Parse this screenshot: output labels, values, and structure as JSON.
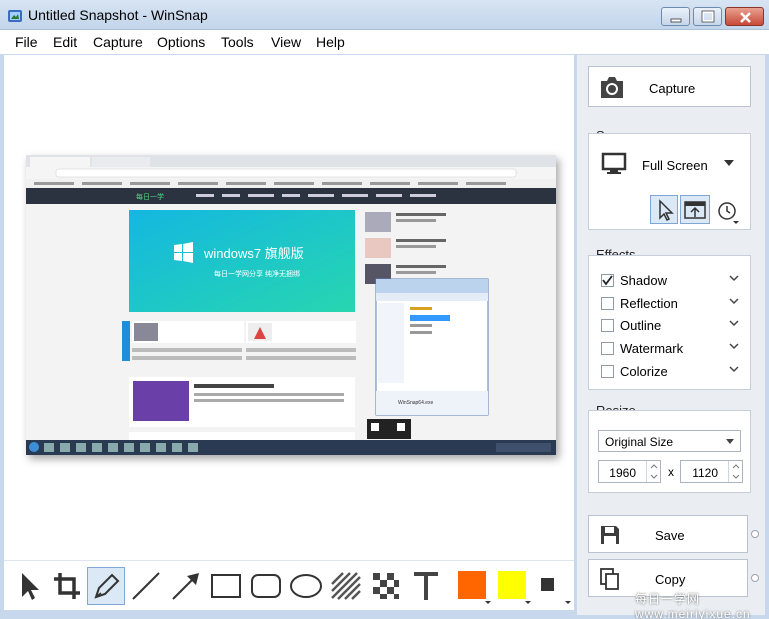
{
  "window": {
    "title": "Untitled Snapshot - WinSnap"
  },
  "menu": [
    "File",
    "Edit",
    "Capture",
    "Options",
    "Tools",
    "View",
    "Help"
  ],
  "panel": {
    "capture_label": "Capture",
    "source": {
      "title": "Source",
      "mode": "Full Screen"
    },
    "effects": {
      "title": "Effects",
      "items": [
        {
          "label": "Shadow",
          "checked": true
        },
        {
          "label": "Reflection",
          "checked": false
        },
        {
          "label": "Outline",
          "checked": false
        },
        {
          "label": "Watermark",
          "checked": false
        },
        {
          "label": "Colorize",
          "checked": false
        }
      ]
    },
    "resize": {
      "title": "Resize",
      "mode": "Original Size",
      "width": "1960",
      "separator": "x",
      "height": "1120"
    },
    "save_label": "Save",
    "copy_label": "Copy"
  },
  "toolbar": {
    "colors": {
      "primary": "#ff6600",
      "secondary": "#ffff00"
    },
    "tools": [
      "pointer-tool",
      "crop-tool",
      "pen-tool",
      "line-tool",
      "arrow-tool",
      "rectangle-tool",
      "rounded-rectangle-tool",
      "ellipse-tool",
      "hatch-tool",
      "pixelate-tool",
      "text-tool"
    ]
  },
  "screenshot": {
    "banner_title": "windows7 旗舰版",
    "banner_subtitle": "每日一学网分享 纯净无捆绑",
    "explorer_file": "WinSnap64.exe"
  },
  "watermark": "每日一学网 www.meiriyixue.cn"
}
